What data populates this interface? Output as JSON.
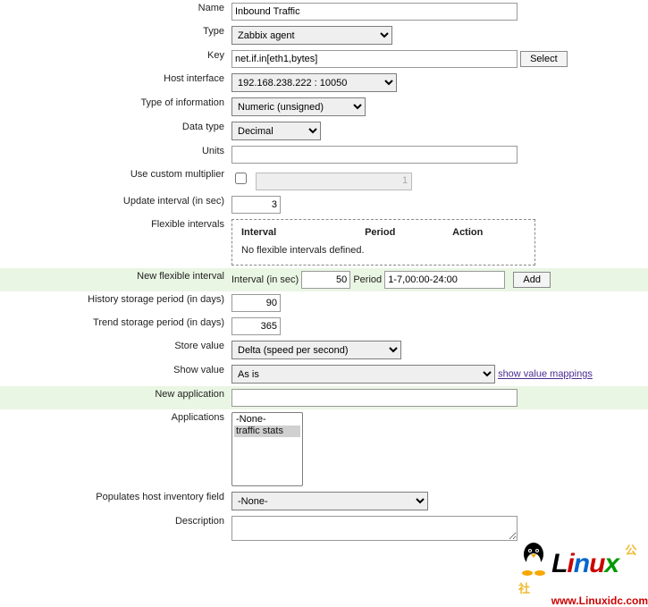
{
  "labels": {
    "name": "Name",
    "type": "Type",
    "key": "Key",
    "host_interface": "Host interface",
    "type_of_info": "Type of information",
    "data_type": "Data type",
    "units": "Units",
    "custom_mult": "Use custom multiplier",
    "update_interval": "Update interval (in sec)",
    "flex_intervals": "Flexible intervals",
    "new_flex": "New flexible interval",
    "history": "History storage period (in days)",
    "trend": "Trend storage period (in days)",
    "store_value": "Store value",
    "show_value": "Show value",
    "new_app": "New application",
    "applications": "Applications",
    "pop_host_inv": "Populates host inventory field",
    "description": "Description"
  },
  "values": {
    "name": "Inbound Traffic",
    "type": "Zabbix agent",
    "key": "net.if.in[eth1,bytes]",
    "select_btn": "Select",
    "host_interface": "192.168.238.222 : 10050",
    "type_of_info": "Numeric (unsigned)",
    "data_type": "Decimal",
    "units": "",
    "custom_mult_disabled": "1",
    "update_interval": "3",
    "flex_hdr_interval": "Interval",
    "flex_hdr_period": "Period",
    "flex_hdr_action": "Action",
    "flex_none": "No flexible intervals defined.",
    "newflex_interval_lbl": "Interval (in sec)",
    "newflex_interval": "50",
    "newflex_period_lbl": "Period",
    "newflex_period": "1-7,00:00-24:00",
    "add_btn": "Add",
    "history": "90",
    "trend": "365",
    "store_value": "Delta (speed per second)",
    "show_value": "As is",
    "show_value_link": "show value mappings",
    "new_app": "",
    "app_none": "-None-",
    "app_traffic": "traffic stats",
    "pop_host_inv": "-None-",
    "description": ""
  },
  "watermark": {
    "text": "Linux",
    "cn": "公社",
    "url": "www.Linuxidc.com"
  }
}
